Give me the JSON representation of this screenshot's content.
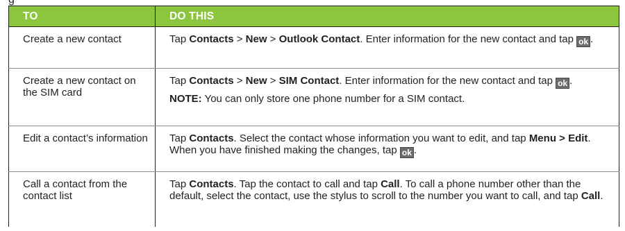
{
  "header": {
    "col1": "TO",
    "col2": "DO THIS"
  },
  "caption": "g",
  "ok_icon_text": "ok",
  "rows": [
    {
      "to": "Create a new contact",
      "do": [
        {
          "t": "Tap "
        },
        {
          "b": "Contacts"
        },
        {
          "t": " > "
        },
        {
          "b": "New"
        },
        {
          "t": " > "
        },
        {
          "b": "Outlook Contact"
        },
        {
          "t": ". Enter information for the new contact and tap "
        },
        {
          "icon": "ok"
        },
        {
          "t": "."
        }
      ]
    },
    {
      "to": "Create a new contact on the SIM card",
      "do": [
        {
          "t": "Tap "
        },
        {
          "b": "Contacts"
        },
        {
          "t": " > "
        },
        {
          "b": "New"
        },
        {
          "t": " > "
        },
        {
          "b": "SIM Contact"
        },
        {
          "t": ". Enter information for the new contact and tap "
        },
        {
          "icon": "ok"
        },
        {
          "t": "."
        }
      ],
      "note_label": "NOTE:",
      "note_text": " You can only store one phone number for a SIM contact."
    },
    {
      "to": "Edit a contact’s information",
      "do": [
        {
          "t": "Tap "
        },
        {
          "b": "Contacts"
        },
        {
          "t": ". Select the contact whose information you want to edit, and tap "
        },
        {
          "b": "Menu > Edit"
        },
        {
          "t": ". When you have finished making the changes, tap "
        },
        {
          "icon": "ok"
        },
        {
          "t": "."
        }
      ]
    },
    {
      "to": "Call a contact from the contact list",
      "do": [
        {
          "t": "Tap "
        },
        {
          "b": "Contacts"
        },
        {
          "t": ". Tap the contact to call and tap "
        },
        {
          "b": "Call"
        },
        {
          "t": ". To call a phone number other than the default, select the contact, use the stylus to scroll to the number you want to call, and tap "
        },
        {
          "b": "Call"
        },
        {
          "t": "."
        }
      ]
    }
  ]
}
